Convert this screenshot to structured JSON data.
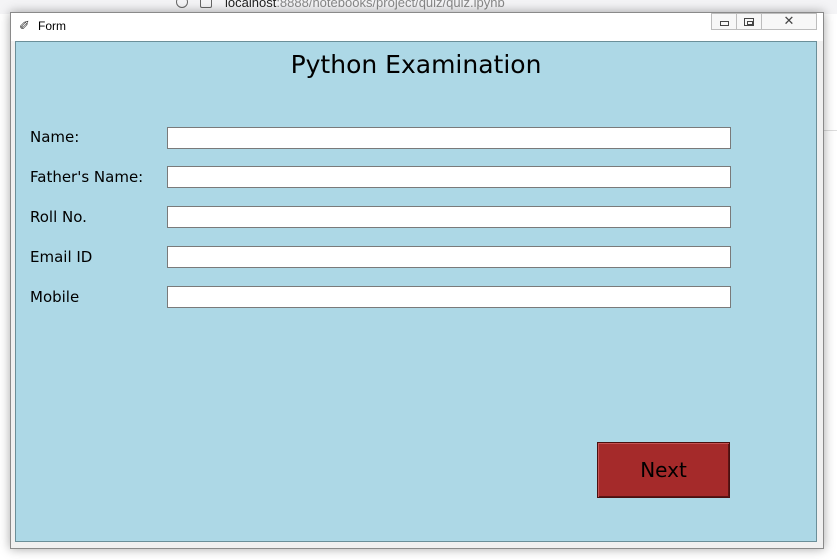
{
  "browser": {
    "url_host": "localhost",
    "url_rest": ":8888/notebooks/project/quiz/quiz.ipynb"
  },
  "window": {
    "title": "Form",
    "icon": "feather-icon",
    "controls": {
      "minimize": "▭",
      "maximize": "▣",
      "close": "⨯⨯"
    }
  },
  "form": {
    "title": "Python Examination",
    "fields": [
      {
        "label": "Name:",
        "value": ""
      },
      {
        "label": "Father's Name:",
        "value": ""
      },
      {
        "label": "Roll No.",
        "value": ""
      },
      {
        "label": "Email ID",
        "value": ""
      },
      {
        "label": "Mobile",
        "value": ""
      }
    ],
    "next_label": "Next"
  },
  "colors": {
    "form_bg": "#add8e6",
    "next_bg": "#a52a2a"
  }
}
